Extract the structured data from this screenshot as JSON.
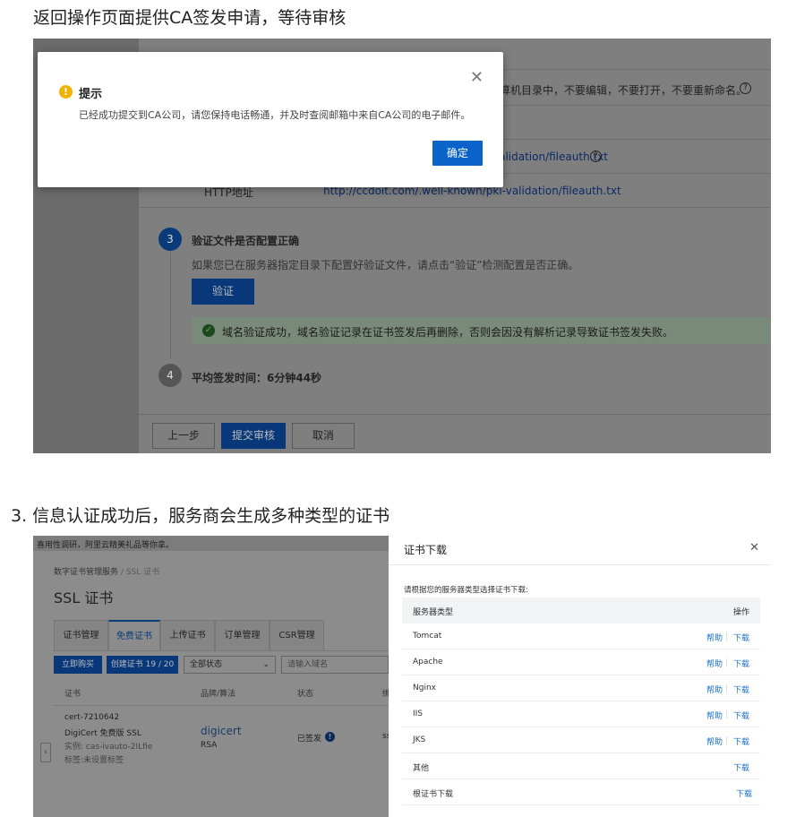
{
  "caption1": "返回操作页面提供CA签发申请，等待审核",
  "caption2": "3. 信息认证成功后，服务商会生成多种类型的证书",
  "shot1": {
    "rows": [
      {
        "text": "计算机目录中，不要编辑，不要打开，不要重新命名。"
      },
      {
        "link": "validation/fileauth.txt"
      },
      {
        "label": "HTTP地址",
        "link": "http://ccdoit.com/.well-known/pki-validation/fileauth.txt"
      }
    ],
    "step3": {
      "number": "3",
      "title": "验证文件是否配置正确",
      "desc": "如果您已在服务器指定目录下配置好验证文件，请点击“验证”检测配置是否正确。",
      "verify_label": "验证",
      "success_icon": "check-circle-icon",
      "success_msg": "域名验证成功，域名验证记录在证书签发后再删除，否则会因没有解析记录导致证书签发失败。"
    },
    "step4": {
      "number": "4",
      "text": "平均签发时间：6分钟44秒"
    },
    "footer": {
      "prev": "上一步",
      "submit": "提交审核",
      "cancel": "取消"
    },
    "dialog": {
      "title": "提示",
      "body": "已经成功提交到CA公司，请您保持电话畅通，并及时查阅邮箱中来自CA公司的电子邮件。",
      "ok": "确定",
      "close_icon": "close-icon",
      "warn_icon": "warning-icon"
    }
  },
  "shot2": {
    "topbar": "喜用性调研，阿里云精美礼品等你拿。",
    "breadcrumb": {
      "root": "数字证书管理服务",
      "sep": "/",
      "current": "SSL 证书"
    },
    "title": "SSL 证书",
    "tabs": [
      "证书管理",
      "免费证书",
      "上传证书",
      "订单管理",
      "CSR管理"
    ],
    "buy_label": "立即购买",
    "create_label": "创建证书 19 / 20",
    "status_select": "全部状态",
    "search_placeholder": "请输入域名",
    "columns": [
      "证书",
      "品牌/算法",
      "状态",
      "绑"
    ],
    "cert": {
      "id": "cert-7210642",
      "name": "DigiCert 免费版 SSL",
      "instance": "实例: cas-ivauto-2ILfie",
      "tag": "标签:未设置标签",
      "brand": "digicert",
      "algo": "RSA",
      "status": "已签发",
      "extra": "ss"
    },
    "drawer": {
      "title": "证书下载",
      "hint": "请根据您的服务器类型选择证书下载:",
      "col_type": "服务器类型",
      "col_action": "操作",
      "help_label": "帮助",
      "download_label": "下载",
      "rows": [
        {
          "name": "Tomcat",
          "help": "帮助",
          "download": "下载"
        },
        {
          "name": "Apache",
          "help": "帮助",
          "download": "下载"
        },
        {
          "name": "Nginx",
          "help": "帮助",
          "download": "下载"
        },
        {
          "name": "IIS",
          "help": "帮助",
          "download": "下载"
        },
        {
          "name": "JKS",
          "help": "帮助",
          "download": "下载"
        },
        {
          "name": "其他",
          "help": "",
          "download": "下载"
        },
        {
          "name": "根证书下载",
          "help": "",
          "download": "下载"
        }
      ]
    }
  },
  "colors": {
    "primary": "#0a63c9",
    "link": "#1a6fd0",
    "warning": "#f0b400",
    "success": "#2e9e44"
  }
}
